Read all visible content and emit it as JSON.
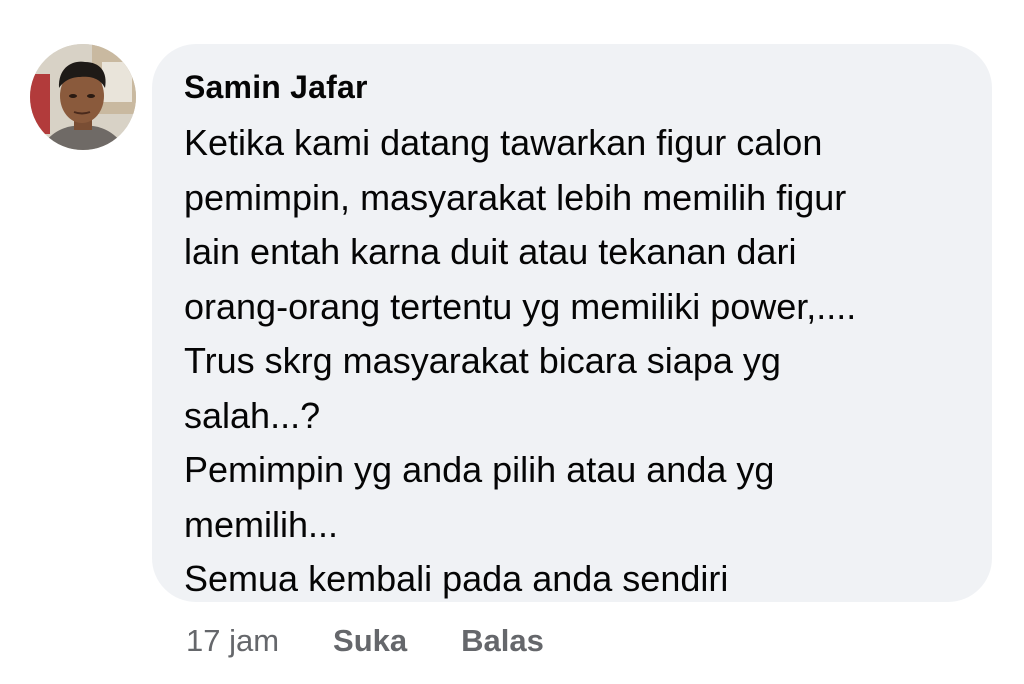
{
  "comment": {
    "author": "Samin Jafar",
    "text_lines": [
      "Ketika kami datang tawarkan figur calon",
      "pemimpin, masyarakat lebih memilih figur",
      "lain entah karna duit atau tekanan dari",
      "orang-orang tertentu yg memiliki power,....",
      "Trus skrg masyarakat bicara siapa yg",
      "salah...?",
      "Pemimpin yg anda pilih atau anda yg",
      "memilih...",
      "Semua kembali pada anda sendiri"
    ],
    "timestamp": "17 jam",
    "like_label": "Suka",
    "reply_label": "Balas"
  },
  "colors": {
    "bubble_background": "#f0f2f5",
    "text_primary": "#050505",
    "text_secondary": "#65676b"
  }
}
